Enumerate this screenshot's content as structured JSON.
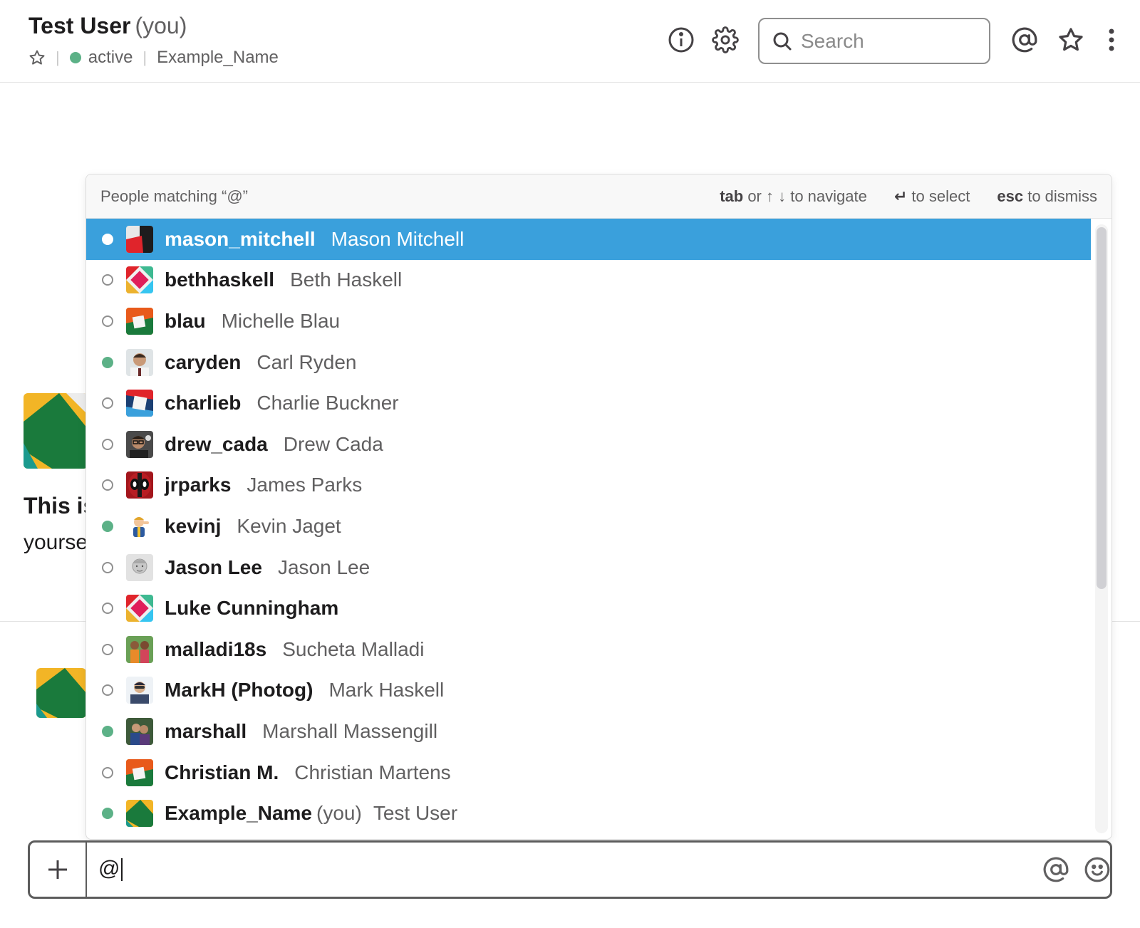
{
  "header": {
    "title": "Test User",
    "title_suffix": "(you)",
    "status": "active",
    "display_name": "Example_Name",
    "search_placeholder": "Search",
    "icons": [
      "star-icon",
      "info-icon",
      "gear-icon",
      "search-icon",
      "at-icon",
      "star-icon",
      "more-icon"
    ]
  },
  "background": {
    "heading": "This is",
    "subtext": "yourse"
  },
  "autocomplete": {
    "title": "People matching “@”",
    "hint_navigate_key": "tab",
    "hint_navigate_text": "or ↑ ↓ to navigate",
    "hint_select_key": "↵",
    "hint_select_text": "to select",
    "hint_dismiss_key": "esc",
    "hint_dismiss_text": "to dismiss",
    "people": [
      {
        "handle": "mason_mitchell",
        "name": "Mason Mitchell",
        "you": "",
        "online": true,
        "selected": true,
        "avatar": "a1"
      },
      {
        "handle": "bethhaskell",
        "name": "Beth Haskell",
        "you": "",
        "online": false,
        "selected": false,
        "avatar": "a2"
      },
      {
        "handle": "blau",
        "name": "Michelle Blau",
        "you": "",
        "online": false,
        "selected": false,
        "avatar": "a3"
      },
      {
        "handle": "caryden",
        "name": "Carl Ryden",
        "you": "",
        "online": true,
        "selected": false,
        "avatar": "p1"
      },
      {
        "handle": "charlieb",
        "name": "Charlie Buckner",
        "you": "",
        "online": false,
        "selected": false,
        "avatar": "a4"
      },
      {
        "handle": "drew_cada",
        "name": "Drew Cada",
        "you": "",
        "online": false,
        "selected": false,
        "avatar": "p2"
      },
      {
        "handle": "jrparks",
        "name": "James Parks",
        "you": "",
        "online": false,
        "selected": false,
        "avatar": "p3"
      },
      {
        "handle": "kevinj",
        "name": "Kevin Jaget",
        "you": "",
        "online": true,
        "selected": false,
        "avatar": "p4"
      },
      {
        "handle": "Jason Lee",
        "name": "Jason Lee",
        "you": "",
        "online": false,
        "selected": false,
        "avatar": "p5"
      },
      {
        "handle": "Luke Cunningham",
        "name": "",
        "you": "",
        "online": false,
        "selected": false,
        "avatar": "a2"
      },
      {
        "handle": "malladi18s",
        "name": "Sucheta Malladi",
        "you": "",
        "online": false,
        "selected": false,
        "avatar": "p6"
      },
      {
        "handle": "MarkH (Photog)",
        "name": "Mark Haskell",
        "you": "",
        "online": false,
        "selected": false,
        "avatar": "p7"
      },
      {
        "handle": "marshall",
        "name": "Marshall Massengill",
        "you": "",
        "online": true,
        "selected": false,
        "avatar": "p8"
      },
      {
        "handle": "Christian M.",
        "name": "Christian Martens",
        "you": "",
        "online": false,
        "selected": false,
        "avatar": "a3"
      },
      {
        "handle": "Example_Name",
        "name": "Test User",
        "you": "(you)",
        "online": true,
        "selected": false,
        "avatar": "a5"
      }
    ]
  },
  "composer": {
    "text": "@",
    "icons": [
      "plus-icon",
      "at-icon",
      "emoji-icon"
    ]
  },
  "colors": {
    "selected_row": "#3aa0dc",
    "online": "#5cb187",
    "border": "#5c5c5c"
  }
}
